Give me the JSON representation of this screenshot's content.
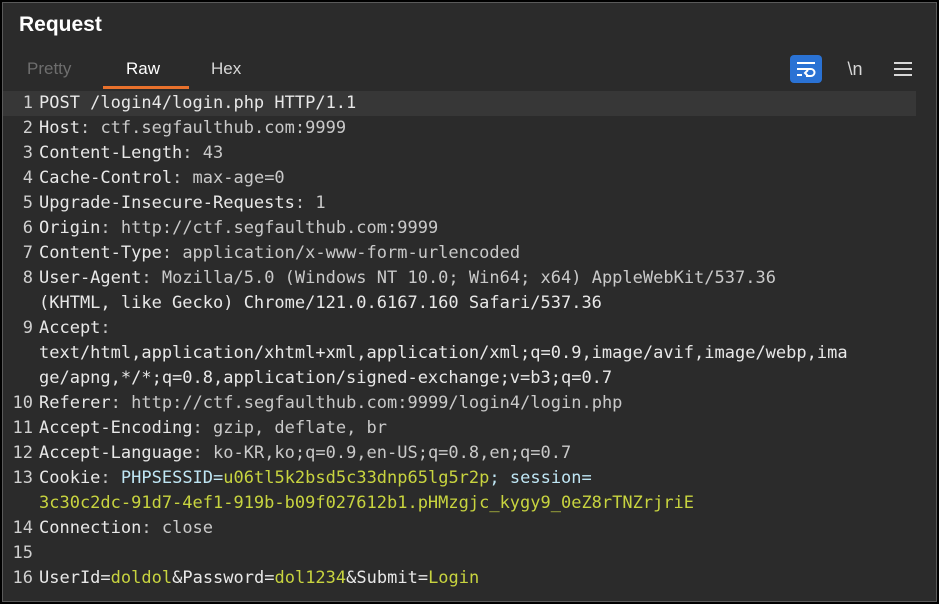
{
  "panel": {
    "title": "Request"
  },
  "tabs": [
    {
      "label": "Pretty",
      "active": false
    },
    {
      "label": "Raw",
      "active": true
    },
    {
      "label": "Hex",
      "active": false
    }
  ],
  "toolbar": {
    "wrap_icon": "wrap-lines-icon",
    "newline_label": "\\n",
    "menu_icon": "hamburger-menu-icon",
    "accent_color": "#2a72d4"
  },
  "editor": {
    "lines": [
      {
        "num": "1",
        "text": "POST /login4/login.php HTTP/1.1"
      },
      {
        "num": "2",
        "key": "Host",
        "value": "ctf.segfaulthub.com:9999"
      },
      {
        "num": "3",
        "key": "Content-Length",
        "value": "43"
      },
      {
        "num": "4",
        "key": "Cache-Control",
        "value": "max-age=0"
      },
      {
        "num": "5",
        "key": "Upgrade-Insecure-Requests",
        "value": "1"
      },
      {
        "num": "6",
        "key": "Origin",
        "value": "http://ctf.segfaulthub.com:9999"
      },
      {
        "num": "7",
        "key": "Content-Type",
        "value": "application/x-www-form-urlencoded"
      },
      {
        "num": "8",
        "key": "User-Agent",
        "value": "Mozilla/5.0 (Windows NT 10.0; Win64; x64) AppleWebKit/537.36"
      },
      {
        "num": "",
        "text": "(KHTML, like Gecko) Chrome/121.0.6167.160 Safari/537.36"
      },
      {
        "num": "9",
        "key": "Accept",
        "value": ""
      },
      {
        "num": "",
        "text": "text/html,application/xhtml+xml,application/xml;q=0.9,image/avif,image/webp,ima"
      },
      {
        "num": "",
        "text": "ge/apng,*/*;q=0.8,application/signed-exchange;v=b3;q=0.7"
      },
      {
        "num": "10",
        "key": "Referer",
        "value": "http://ctf.segfaulthub.com:9999/login4/login.php"
      },
      {
        "num": "11",
        "key": "Accept-Encoding",
        "value": "gzip, deflate, br"
      },
      {
        "num": "12",
        "key": "Accept-Language",
        "value": "ko-KR,ko;q=0.9,en-US;q=0.8,en;q=0.7"
      },
      {
        "num": "13",
        "key": "Cookie"
      },
      {
        "num": "",
        "cookie_cont": "3c30c2dc-91d7-4ef1-919b-b09f027612b1.pHMzgjc_kygy9_0eZ8rTNZrjriE"
      },
      {
        "num": "14",
        "key": "Connection",
        "value": "close"
      },
      {
        "num": "15",
        "text": ""
      },
      {
        "num": "16"
      }
    ],
    "cookie": {
      "name1": "PHPSESSID",
      "eq": "=",
      "value1": "u06tl5k2bsd5c33dnp65lg5r2p",
      "sep": "; ",
      "name2": "session",
      "eq2": "="
    },
    "body": {
      "k1": "UserId",
      "v1": "doldol",
      "k2": "Password",
      "v2": "dol1234",
      "k3": "Submit",
      "v3": "Login",
      "eq": "=",
      "amp": "&"
    },
    "colors": {
      "cookie_name": "#bfe6f4",
      "cookie_value": "#c8d43f"
    }
  }
}
